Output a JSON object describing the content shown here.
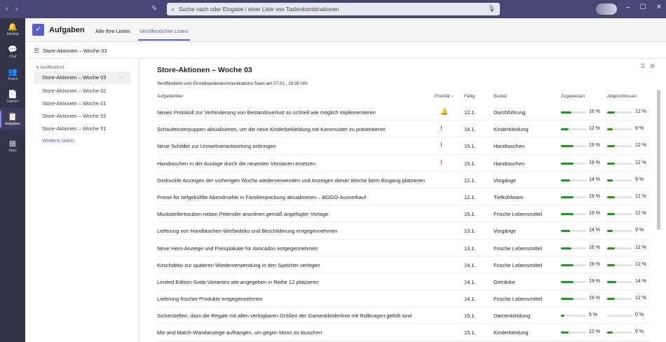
{
  "search": {
    "placeholder": "Suche nach oder Eingabe / einer Liste von Tastenkombinationen"
  },
  "rail": [
    {
      "label": "Aktivität",
      "icon": "bell-icon",
      "glyph": "🔔"
    },
    {
      "label": "Chat",
      "icon": "chat-icon",
      "glyph": "💬"
    },
    {
      "label": "Teams",
      "icon": "teams-icon",
      "glyph": "👥"
    },
    {
      "label": "Dateien",
      "icon": "files-icon",
      "glyph": "📄"
    },
    {
      "label": "Aufgaben",
      "icon": "tasks-icon",
      "glyph": "📋"
    },
    {
      "label": "Apps",
      "icon": "apps-icon",
      "glyph": "▦"
    }
  ],
  "app": {
    "title": "Aufgaben",
    "tabs": [
      "Alle Ihre Listen",
      "Veröffentlichte Listen"
    ]
  },
  "breadcrumb": "Store-Aktionen – Woche 03",
  "sidebar": {
    "section": "Veröffentlicht",
    "items": [
      "Store-Aktionen – Woche 03",
      "Store-Aktionen – Woche 02",
      "Store-Aktionen – Woche 01",
      "Store-Aktionen – Woche 52",
      "Store-Aktionen – Woche 51"
    ],
    "more_glyph": "···",
    "load_more": "Weitere laden"
  },
  "main": {
    "title": "Store-Aktionen – Woche 03",
    "subtitle": "Veröffentlicht vom Einzelhandelskommunikations-Team am 07.01., 19:35 Uhr",
    "columns": {
      "title": "Aufgabentitel",
      "priority": "Priorität ↓",
      "due": "Fällig",
      "bucket": "Bucket",
      "assigned": "Zugewiesen",
      "completed": "Abgeschlossen"
    },
    "rows": [
      {
        "title": "Neues Protokoll zur Verhinderung von Bestandsverlust so schnell wie möglich implementieren",
        "priority": "urgent",
        "due": "12.1.",
        "bucket": "Durchführung",
        "assigned": "16 %",
        "assigned_value": 16,
        "completed": "12 %",
        "completed_value": 12
      },
      {
        "title": "Schaufensterpuppen aktualisieren, um die neue Kinderbekleidung mit Karomuster zu präsentieren",
        "priority": "important",
        "due": "14.1.",
        "bucket": "Kinderkleidung",
        "assigned": "12 %",
        "assigned_value": 12,
        "completed": "9 %",
        "completed_value": 9
      },
      {
        "title": "Neue Schilder zur Umweltverantwortung anbringen",
        "priority": "important",
        "due": "15.1.",
        "bucket": "Handtaschen",
        "assigned": "19 %",
        "assigned_value": 19,
        "completed": "12 %",
        "completed_value": 12
      },
      {
        "title": "Handtaschen in der Auslage durch die neuesten Versionen ersetzen",
        "priority": "important",
        "due": "15.1.",
        "bucket": "Handtaschen",
        "assigned": "19 %",
        "assigned_value": 19,
        "completed": "12 %",
        "completed_value": 12
      },
      {
        "title": "Gedruckte Anzeigen der vorherigen Woche wiederverwenden und Anzeigen dieser Woche beim Eingang platzieren",
        "priority": "",
        "due": "12.1.",
        "bucket": "Vorgänge",
        "assigned": "14 %",
        "assigned_value": 14,
        "completed": "9 %",
        "completed_value": 9
      },
      {
        "title": "Preise für tiefgekühlte Abendmahle in Familienpackung aktualisieren – BOGO-Ausverkauf",
        "priority": "",
        "due": "12.1.",
        "bucket": "Tiefkühlware",
        "assigned": "19 %",
        "assigned_value": 19,
        "completed": "12 %",
        "completed_value": 12
      },
      {
        "title": "Muskatellertrauben neben Petersilie anordnen gemäß angefügter Vorlage",
        "priority": "",
        "due": "15.1.",
        "bucket": "Frische Lebensmittel",
        "assigned": "19 %",
        "assigned_value": 19,
        "completed": "12 %",
        "completed_value": 12
      },
      {
        "title": "Lieferung von Handtaschen-Werbedeko und Beschilderung entgegennehmen",
        "priority": "",
        "due": "13.1.",
        "bucket": "Vorgänge",
        "assigned": "14 %",
        "assigned_value": 14,
        "completed": "9 %",
        "completed_value": 9
      },
      {
        "title": "Neue Hero-Anzeige und Preisplakate für Avocados entgegennehmen",
        "priority": "",
        "due": "13.1.",
        "bucket": "Frische Lebensmittel",
        "assigned": "16 %",
        "assigned_value": 16,
        "completed": "12 %",
        "completed_value": 12
      },
      {
        "title": "Kirschdeko zur späteren Wiederverwendung in den Speicher verlegen",
        "priority": "",
        "due": "14.1.",
        "bucket": "Frische Lebensmittel",
        "assigned": "19 %",
        "assigned_value": 19,
        "completed": "12 %",
        "completed_value": 12
      },
      {
        "title": "Limited Edition-Soda-Varianten wie angegeben in Reihe 12 platzieren",
        "priority": "",
        "due": "14.1.",
        "bucket": "Getränke",
        "assigned": "19 %",
        "assigned_value": 19,
        "completed": "14 %",
        "completed_value": 14
      },
      {
        "title": "Lieferung frischer Produkte entgegennehmen",
        "priority": "",
        "due": "14.1.",
        "bucket": "Frische Lebensmittel",
        "assigned": "19 %",
        "assigned_value": 19,
        "completed": "12 %",
        "completed_value": 12
      },
      {
        "title": "Sicherstellen, dass die Regale mit allen verfügbaren Größen der Damenkleiderlinie mit Rollkragen gefüllt sind",
        "priority": "",
        "due": "15.1.",
        "bucket": "Damenkleidung",
        "assigned": "5 %",
        "assigned_value": 5,
        "completed": "0 %",
        "completed_value": 0
      },
      {
        "title": "Mix and Match-Wandanzeige aufhängen, um gegen Mono zu tauschen",
        "priority": "",
        "due": "15.1.",
        "bucket": "Kinderkleidung",
        "assigned": "12 %",
        "assigned_value": 12,
        "completed": "9 %",
        "completed_value": 9
      }
    ]
  },
  "colors": {
    "accent": "#5b5fc7",
    "topbar": "#464775",
    "rail": "#33344a",
    "progress": "#13a10e",
    "priority": "#c4314b"
  }
}
